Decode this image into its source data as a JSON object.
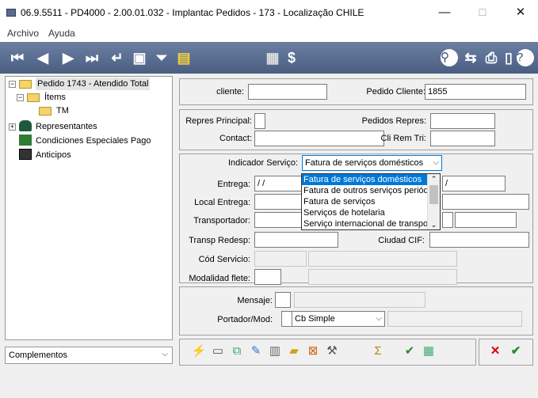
{
  "window": {
    "title": "06.9.5511 - PD4000 - 2.00.01.032 - Implantac Pedidos - 173 - Localização CHILE",
    "minimize": "—",
    "maximize": "☐",
    "close": "✕"
  },
  "menu": {
    "items": [
      "Archivo",
      "Ayuda"
    ]
  },
  "tree": {
    "items": [
      {
        "label": "Pedido 1743 - Atendido Total"
      },
      {
        "label": "Ítems"
      },
      {
        "label": "TM"
      },
      {
        "label": "Representantes"
      },
      {
        "label": "Condiciones Especiales Pago"
      },
      {
        "label": "Anticipos"
      }
    ]
  },
  "complementos": {
    "label": "Complementos"
  },
  "header_panel": {
    "cliente_label": "cliente:",
    "cliente_value": "",
    "pedido_cliente_label": "Pedido Cliente:",
    "pedido_cliente_value": "1855"
  },
  "repres_panel": {
    "repres_principal_label": "Repres Principal:",
    "repres_principal_value": "",
    "pedidos_repres_label": "Pedidos Repres:",
    "pedidos_repres_value": "",
    "contact_label": "Contact:",
    "contact_value": "",
    "cli_rem_tri_label": "Cli Rem Tri:",
    "cli_rem_tri_value": ""
  },
  "service_panel": {
    "indicador_label": "Indicador Serviço:",
    "indicador_value": "Fatura de serviços domésticos",
    "options": [
      "Fatura de serviços domésticos",
      "Fatura de outros serviços periódicos",
      "Fatura de serviços",
      "Serviços de hotelaria",
      "Serviço internacional de transporte"
    ],
    "entrega_label": "Entrega:",
    "entrega_value": " / /",
    "entrega2_value": "/",
    "local_entrega_label": "Local Entrega:",
    "transportador_label": "Transportador:",
    "transp_redesp_label": "Transp Redesp:",
    "ciudad_cif_label": "Ciudad CIF:",
    "cod_servicio_label": "Cód Servicio:",
    "modalidad_flete_label": "Modalidad flete:"
  },
  "mensaje_panel": {
    "mensaje_label": "Mensaje:",
    "portador_label": "Portador/Mod:",
    "portador_value": "",
    "mod_value": "Cb Simple"
  },
  "colors": {
    "toolbar": "#5a6e92",
    "accent": "#0078d7"
  }
}
